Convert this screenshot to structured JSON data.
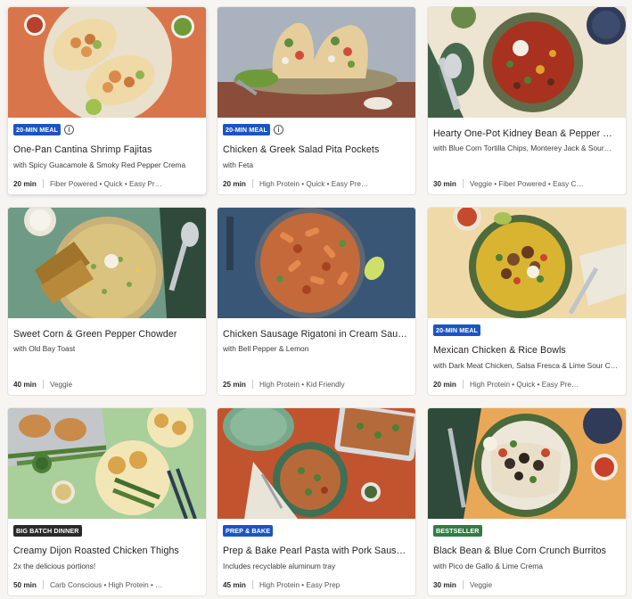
{
  "cards": [
    {
      "badge": "20-MIN MEAL",
      "badge_color": "#1d54c4",
      "info_icon": "info-icon",
      "title": "One-Pan Cantina Shrimp Fajitas",
      "subtitle": "with Spicy Guacamole & Smoky Red Pepper Crema",
      "time": "20 min",
      "tags": "Fiber Powered • Quick • Easy Pr…"
    },
    {
      "badge": "20-MIN MEAL",
      "badge_color": "#1d54c4",
      "info_icon": "info-icon",
      "title": "Chicken & Greek Salad Pita Pockets",
      "subtitle": "with Feta",
      "time": "20 min",
      "tags": "High Protein • Quick • Easy Pre…"
    },
    {
      "badge": "",
      "title": "Hearty One-Pot Kidney Bean & Pepper …",
      "subtitle": "with Blue Corn Tortilla Chips, Monterey Jack & Sour…",
      "time": "30 min",
      "tags": "Veggie • Fiber Powered • Easy C…"
    },
    {
      "badge": "",
      "title": "Sweet Corn & Green Pepper Chowder",
      "subtitle": "with Old Bay Toast",
      "time": "40 min",
      "tags": "Veggie"
    },
    {
      "badge": "",
      "title": "Chicken Sausage Rigatoni in Cream Sau…",
      "subtitle": "with Bell Pepper & Lemon",
      "time": "25 min",
      "tags": "High Protein • Kid Friendly"
    },
    {
      "badge": "20-MIN MEAL",
      "badge_color": "#1d54c4",
      "title": "Mexican Chicken & Rice Bowls",
      "subtitle": "with Dark Meat Chicken, Salsa Fresca & Lime Sour C…",
      "time": "20 min",
      "tags": "High Protein • Quick • Easy Pre…"
    },
    {
      "badge": "BIG BATCH DINNER",
      "badge_color": "#2a2a2a",
      "title": "Creamy Dijon Roasted Chicken Thighs",
      "subtitle": "2x the delicious portions!",
      "time": "50 min",
      "tags": "Carb Conscious • High Protein • …"
    },
    {
      "badge": "PREP & BAKE",
      "badge_color": "#1d54c4",
      "title": "Prep & Bake Pearl Pasta with Pork Saus…",
      "subtitle": "Includes recyclable aluminum tray",
      "time": "45 min",
      "tags": "High Protein • Easy Prep"
    },
    {
      "badge": "BESTSELLER",
      "badge_color": "#2f7d43",
      "title": "Black Bean & Blue Corn Crunch Burritos",
      "subtitle": "with Pico de Gallo & Lime Crema",
      "time": "30 min",
      "tags": "Veggie"
    }
  ],
  "info_icon_glyph": "i"
}
